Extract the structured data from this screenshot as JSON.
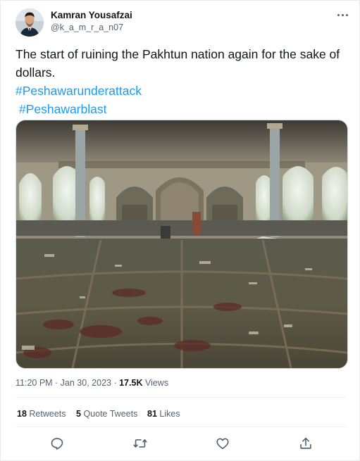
{
  "tweet": {
    "author": {
      "display_name": "Kamran Yousafzai",
      "handle": "@k_a_m_r_a_n07"
    },
    "text": "The start of ruining the Pakhtun nation again for the sake of dollars.",
    "hashtags": [
      "#Peshawarunderattack",
      "#Peshawarblast"
    ],
    "media": {
      "alt": "Damaged mosque prayer hall interior with debris and bloodstained carpet"
    },
    "time": "11:20 PM · Jan 30, 2023",
    "separator": "·",
    "views_count": "17.5K",
    "views_label": "Views",
    "stats": {
      "retweets_count": "18",
      "retweets_label": "Retweets",
      "quotes_count": "5",
      "quotes_label": "Quote Tweets",
      "likes_count": "81",
      "likes_label": "Likes"
    },
    "actions": [
      "reply-icon",
      "retweet-icon",
      "like-icon",
      "share-icon"
    ]
  },
  "colors": {
    "link": "#1d9bf0",
    "text": "#0f1419",
    "secondary": "#536471",
    "border": "#eff3f4"
  }
}
